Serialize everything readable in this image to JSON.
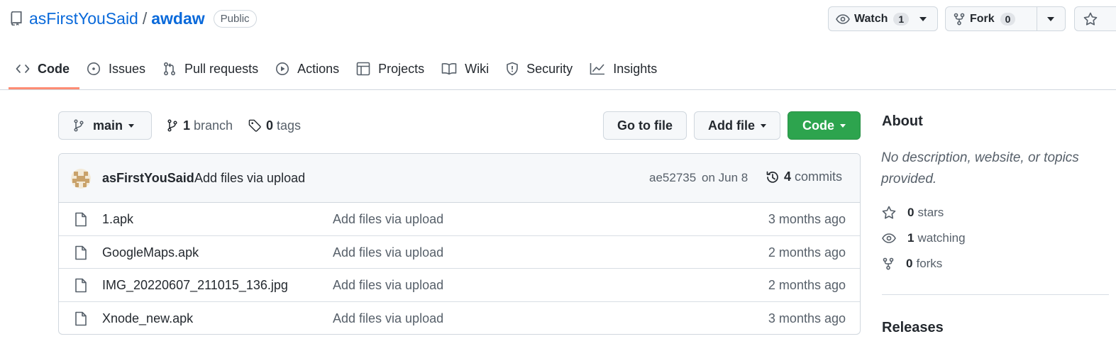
{
  "repo": {
    "owner": "asFirstYouSaid",
    "separator": "/",
    "name": "awdaw",
    "visibility": "Public"
  },
  "actions": {
    "watch_label": "Watch",
    "watch_count": "1",
    "fork_label": "Fork",
    "fork_count": "0"
  },
  "tabs": [
    {
      "label": "Code",
      "icon": "code-icon",
      "active": true
    },
    {
      "label": "Issues",
      "icon": "issue-opened-icon"
    },
    {
      "label": "Pull requests",
      "icon": "git-pull-request-icon"
    },
    {
      "label": "Actions",
      "icon": "play-icon"
    },
    {
      "label": "Projects",
      "icon": "table-icon"
    },
    {
      "label": "Wiki",
      "icon": "book-icon"
    },
    {
      "label": "Security",
      "icon": "shield-icon"
    },
    {
      "label": "Insights",
      "icon": "graph-icon"
    }
  ],
  "toolbar": {
    "branch": "main",
    "branch_count": "1",
    "branch_word": "branch",
    "tag_count": "0",
    "tag_word": "tags",
    "go_to_file": "Go to file",
    "add_file": "Add file",
    "code": "Code"
  },
  "latest_commit": {
    "author": "asFirstYouSaid",
    "message": "Add files via upload",
    "sha": "ae52735",
    "date": "on Jun 8",
    "commit_count": "4",
    "commit_word": "commits"
  },
  "files": [
    {
      "name": "1.apk",
      "message": "Add files via upload",
      "age": "3 months ago"
    },
    {
      "name": "GoogleMaps.apk",
      "message": "Add files via upload",
      "age": "2 months ago"
    },
    {
      "name": "IMG_20220607_211015_136.jpg",
      "message": "Add files via upload",
      "age": "2 months ago"
    },
    {
      "name": "Xnode_new.apk",
      "message": "Add files via upload",
      "age": "3 months ago"
    }
  ],
  "about": {
    "title": "About",
    "description": "No description, website, or topics provided.",
    "stars_count": "0",
    "stars_word": "stars",
    "watching_count": "1",
    "watching_word": "watching",
    "forks_count": "0",
    "forks_word": "forks"
  },
  "releases": {
    "title": "Releases"
  },
  "colors": {
    "accent": "#0969da",
    "primary_button": "#2da44e",
    "tab_underline": "#fd8c73"
  }
}
